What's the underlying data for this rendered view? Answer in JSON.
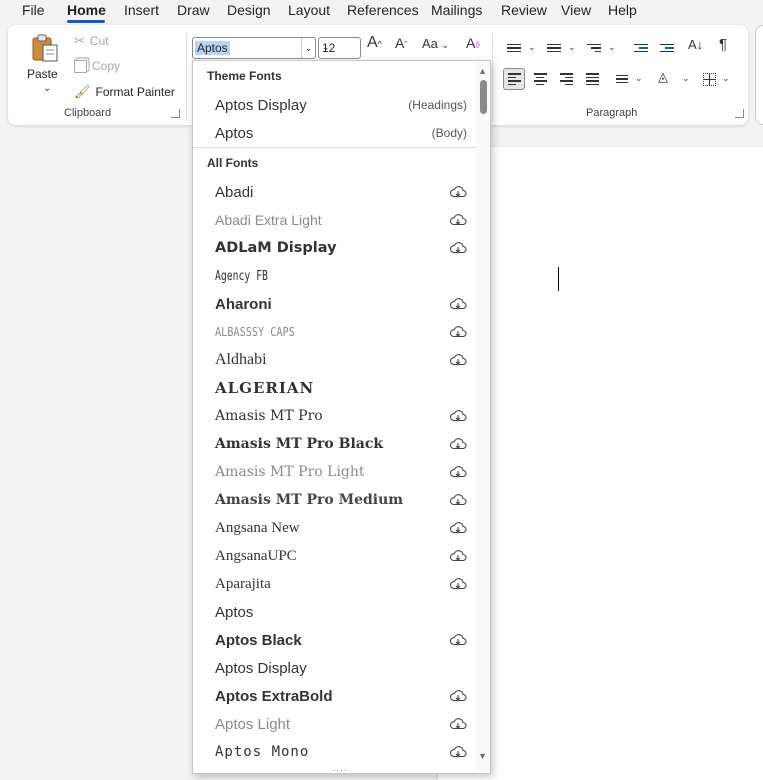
{
  "menu": {
    "tabs": [
      "File",
      "Home",
      "Insert",
      "Draw",
      "Design",
      "Layout",
      "References",
      "Mailings",
      "Review",
      "View",
      "Help"
    ],
    "active": "Home"
  },
  "clipboard": {
    "paste_label": "Paste",
    "cut_label": "Cut",
    "copy_label": "Copy",
    "format_painter_label": "Format Painter",
    "group_label": "Clipboard"
  },
  "font": {
    "name_value": "Aptos",
    "size_value": "12",
    "grow_label": "A",
    "shrink_label": "A",
    "case_label": "Aa"
  },
  "paragraph": {
    "group_label": "Paragraph",
    "pilcrow": "¶"
  },
  "font_dropdown": {
    "theme_header": "Theme Fonts",
    "theme_fonts": [
      {
        "name": "Aptos Display",
        "tag": "(Headings)"
      },
      {
        "name": "Aptos",
        "tag": "(Body)"
      }
    ],
    "all_header": "All Fonts",
    "all_fonts": [
      {
        "name": "Abadi",
        "cloud": true
      },
      {
        "name": "Abadi Extra Light",
        "cloud": true
      },
      {
        "name": "ADLaM Display",
        "cloud": true
      },
      {
        "name": "Agency FB",
        "cloud": false
      },
      {
        "name": "Aharoni",
        "cloud": true
      },
      {
        "name": "ALBASSSY CAPS",
        "cloud": true
      },
      {
        "name": "Aldhabi",
        "cloud": true
      },
      {
        "name": "ALGERIAN",
        "cloud": false
      },
      {
        "name": "Amasis MT Pro",
        "cloud": true
      },
      {
        "name": "Amasis MT Pro Black",
        "cloud": true
      },
      {
        "name": "Amasis MT Pro Light",
        "cloud": true
      },
      {
        "name": "Amasis MT Pro Medium",
        "cloud": true
      },
      {
        "name": "Angsana New",
        "cloud": true
      },
      {
        "name": "AngsanaUPC",
        "cloud": true
      },
      {
        "name": "Aparajita",
        "cloud": true
      },
      {
        "name": "Aptos",
        "cloud": false
      },
      {
        "name": "Aptos Black",
        "cloud": true
      },
      {
        "name": "Aptos Display",
        "cloud": false
      },
      {
        "name": "Aptos ExtraBold",
        "cloud": true
      },
      {
        "name": "Aptos Light",
        "cloud": true
      },
      {
        "name": "Aptos Mono",
        "cloud": true
      }
    ],
    "grip": "....",
    "colors": {
      "selection": "#b5d4f4",
      "accent": "#185abd"
    }
  }
}
